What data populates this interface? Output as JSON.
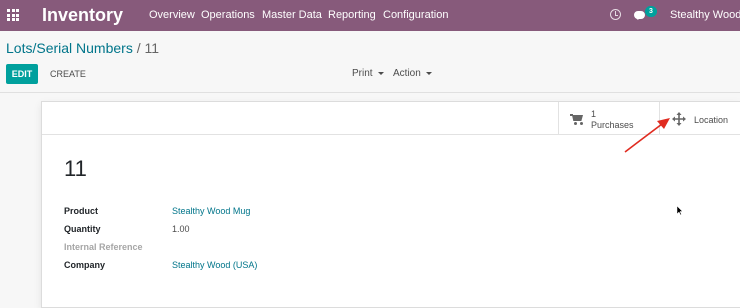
{
  "navbar": {
    "app_name": "Inventory",
    "menus": [
      "Overview",
      "Operations",
      "Master Data",
      "Reporting",
      "Configuration"
    ],
    "chat_count": "3",
    "user": "Stealthy Wood (U"
  },
  "breadcrumb": {
    "parent": "Lots/Serial Numbers",
    "separator": "/",
    "current": "11"
  },
  "toolbar": {
    "edit": "EDIT",
    "create": "CREATE",
    "print": "Print",
    "action": "Action"
  },
  "smart_buttons": {
    "purchases_count": "1",
    "purchases_label": "Purchases",
    "location_label": "Location"
  },
  "form": {
    "title": "11",
    "fields": [
      {
        "label": "Product",
        "value": "Stealthy Wood Mug"
      },
      {
        "label": "Quantity",
        "value": "1.00"
      },
      {
        "label": "Internal Reference",
        "value": ""
      },
      {
        "label": "Company",
        "value": "Stealthy Wood (USA)"
      }
    ]
  },
  "colors": {
    "navbar": "#875a7b",
    "primary_button": "#00a09d",
    "link": "#00758a",
    "annotation_arrow": "#e02b20"
  },
  "icons": [
    "apps-grid-icon",
    "clock-icon",
    "chat-icon",
    "cart-icon",
    "move-arrows-icon",
    "mouse-cursor-icon"
  ]
}
